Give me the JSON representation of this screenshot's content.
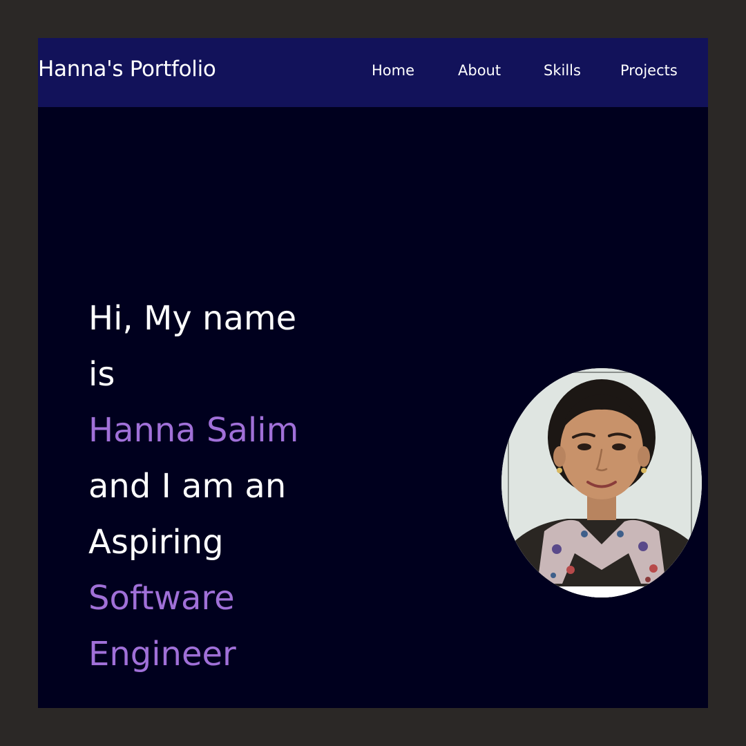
{
  "navbar": {
    "brand": "Hanna's Portfolio",
    "links": [
      {
        "label": "Home"
      },
      {
        "label": "About"
      },
      {
        "label": "Skills"
      },
      {
        "label": "Projects"
      }
    ]
  },
  "hero": {
    "lines": [
      {
        "text": "Hi, My name",
        "accent": false
      },
      {
        "text": "is",
        "accent": false
      },
      {
        "text": "Hanna Salim",
        "accent": true
      },
      {
        "text": "and I am an",
        "accent": false
      },
      {
        "text": "Aspiring",
        "accent": false
      },
      {
        "text": "Software",
        "accent": true
      },
      {
        "text": "Engineer",
        "accent": true
      }
    ]
  },
  "profile_photo": {
    "icon": "profile-photo"
  },
  "colors": {
    "outer_background": "#2b2826",
    "page_background": "#00001e",
    "navbar_background": "#12125a",
    "text": "#ffffff",
    "accent": "#a070d8"
  }
}
